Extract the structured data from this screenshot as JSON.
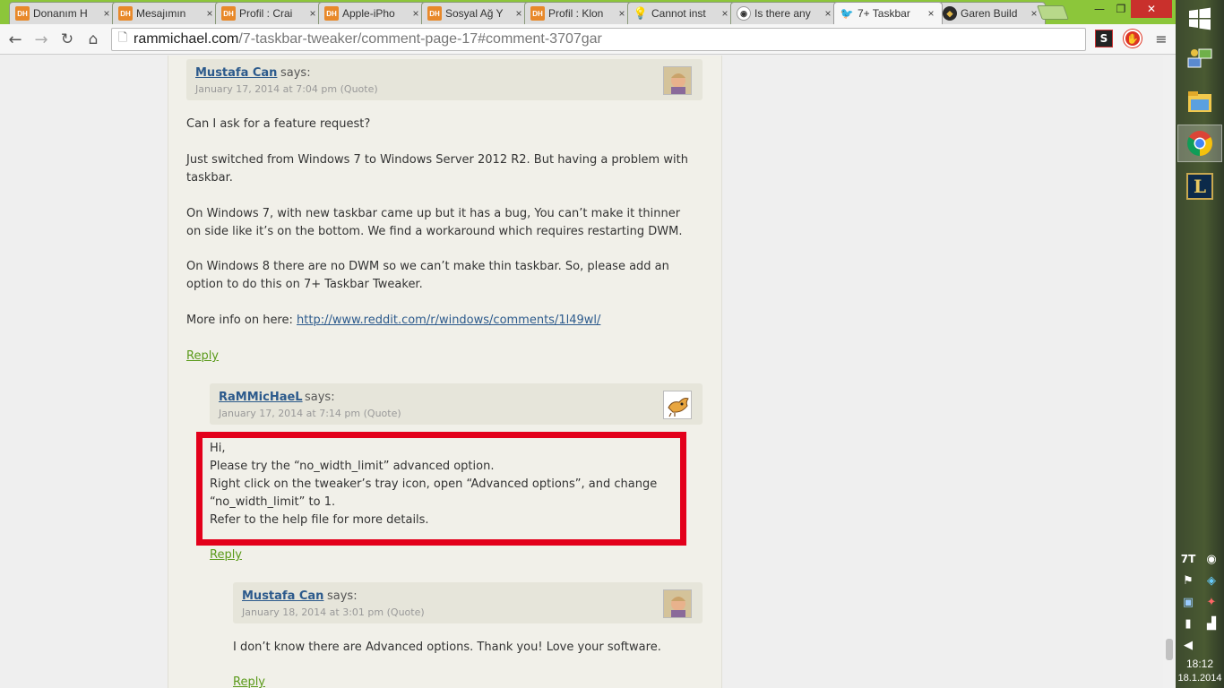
{
  "browser": {
    "tabs": [
      {
        "title": "Donanım H",
        "favicon": "DH",
        "icon": "dh-icon",
        "active": false
      },
      {
        "title": "Mesajımın",
        "favicon": "DH",
        "icon": "dh-icon",
        "active": false
      },
      {
        "title": "Profil : Crai",
        "favicon": "DH",
        "icon": "dh-icon",
        "active": false
      },
      {
        "title": "Apple-iPho",
        "favicon": "DH",
        "icon": "dh-icon",
        "active": false
      },
      {
        "title": "Sosyal Ağ Y",
        "favicon": "DH",
        "icon": "dh-icon",
        "active": false
      },
      {
        "title": "Profil : Klon",
        "favicon": "DH",
        "icon": "dh-icon",
        "active": false
      },
      {
        "title": "Cannot inst",
        "favicon": "💡",
        "icon": "lightbulb-icon",
        "active": false
      },
      {
        "title": "Is there any",
        "favicon": "◉",
        "icon": "reddit-icon",
        "active": false
      },
      {
        "title": "7+ Taskbar",
        "favicon": "🐦",
        "icon": "bird-icon",
        "active": true
      },
      {
        "title": "Garen Build",
        "favicon": "◆",
        "icon": "garen-icon",
        "active": false
      }
    ],
    "tab_close_glyph": "×",
    "window_controls": {
      "minimize": "—",
      "maximize": "❐",
      "close": "✕"
    },
    "nav": {
      "back": "←",
      "forward": "→",
      "reload": "↻",
      "home": "⌂",
      "menu": "≡"
    },
    "page_icon": "🗋",
    "url_host": "rammichael.com",
    "url_path": "/7-taskbar-tweaker/comment-page-17#comment-3707gar",
    "extensions": {
      "ext1": "S",
      "ext2": "✋"
    }
  },
  "comments": [
    {
      "author": "Mustafa Can",
      "says": "says:",
      "meta": "January 17, 2014 at 7:04 pm  (Quote)",
      "paragraphs": [
        [
          "Can I ask for a feature request?"
        ],
        [
          "Just switched from Windows 7 to Windows Server 2012 R2. But having a problem with",
          "taskbar."
        ],
        [
          "On Windows 7, with new taskbar came up but it has a bug, You can’t make it thinner",
          "on side like it’s on the bottom. We find a workaround which requires restarting DWM."
        ],
        [
          "On Windows 8 there are no DWM so we can’t make thin taskbar. So, please add an",
          "option to do this on 7+ Taskbar Tweaker."
        ]
      ],
      "more_info_label": "More info on here: ",
      "more_info_link": "http://www.reddit.com/r/windows/comments/1l49wl/",
      "reply": "Reply"
    },
    {
      "author": "RaMMicHaeL",
      "says": "says:",
      "meta": "January 17, 2014 at 7:14 pm  (Quote)",
      "lines": [
        "Hi,",
        "Please try the “no_width_limit” advanced option.",
        "Right click on the tweaker’s tray icon, open “Advanced options”, and change",
        "“no_width_limit” to 1.",
        "Refer to the help file for more details."
      ],
      "reply": "Reply"
    },
    {
      "author": "Mustafa Can",
      "says": "says:",
      "meta": "January 18, 2014 at 3:01 pm  (Quote)",
      "text": "I don’t know there are Advanced options. Thank you! Love your software.",
      "reply": "Reply"
    }
  ],
  "taskbar": {
    "start": "windows-logo-icon",
    "apps": [
      "network-icon",
      "file-explorer-icon",
      "chrome-icon",
      "league-of-legends-icon"
    ],
    "tray": [
      "7tt-tray-icon",
      "media-icon",
      "flag-icon",
      "network-status-icon",
      "monitor-icon",
      "security-icon",
      "battery-icon",
      "signal-icon",
      "volume-icon"
    ],
    "lol_letter": "L",
    "clock_time": "18:12",
    "clock_date": "18.1.2014"
  }
}
